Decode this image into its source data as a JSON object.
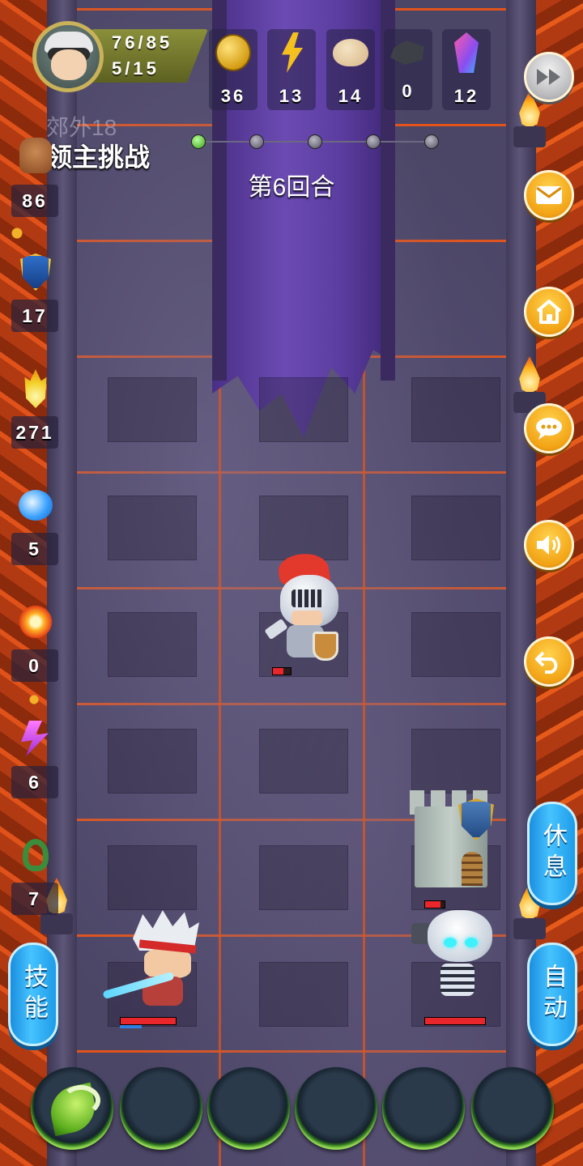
{
  "player": {
    "hp": "76/85",
    "energy": "5/15"
  },
  "resources": [
    {
      "icon": "gold-coin-icon",
      "value": "36"
    },
    {
      "icon": "lightning-bolt-icon",
      "value": "13"
    },
    {
      "icon": "bun-food-icon",
      "value": "14"
    },
    {
      "icon": "iron-ore-icon",
      "value": "0"
    },
    {
      "icon": "crystal-gem-icon",
      "value": "12"
    }
  ],
  "stage": {
    "location": "郊外18",
    "title": "领主挑战",
    "round": "第6回合",
    "progress_steps": 5,
    "progress_current": 1
  },
  "left_stats": [
    {
      "icon": "fist-icon",
      "value": "86"
    },
    {
      "icon": "shield-icon",
      "value": "17"
    },
    {
      "icon": "holy-flame-icon",
      "value": "271"
    },
    {
      "icon": "water-wave-icon",
      "value": "5"
    },
    {
      "icon": "fire-burst-icon",
      "value": "0"
    },
    {
      "icon": "purple-lightning-icon",
      "value": "6"
    },
    {
      "icon": "green-ring-icon",
      "value": "7"
    }
  ],
  "buttons": {
    "rest": "休息",
    "skill": "技能",
    "auto": "自动"
  },
  "side_buttons": [
    "fast-forward-icon",
    "mail-icon",
    "home-icon",
    "chat-icon",
    "sound-icon",
    "undo-icon"
  ],
  "units": {
    "knight_hp": 0.6,
    "tower_hp": 0.8,
    "hero_hp": 1.0,
    "hero_mp": 0.4,
    "skeleton_hp": 1.0
  },
  "colors": {
    "accent_orange": "#f2a315",
    "pill_blue": "#2fb0f5",
    "hp_red": "#e8262b"
  }
}
